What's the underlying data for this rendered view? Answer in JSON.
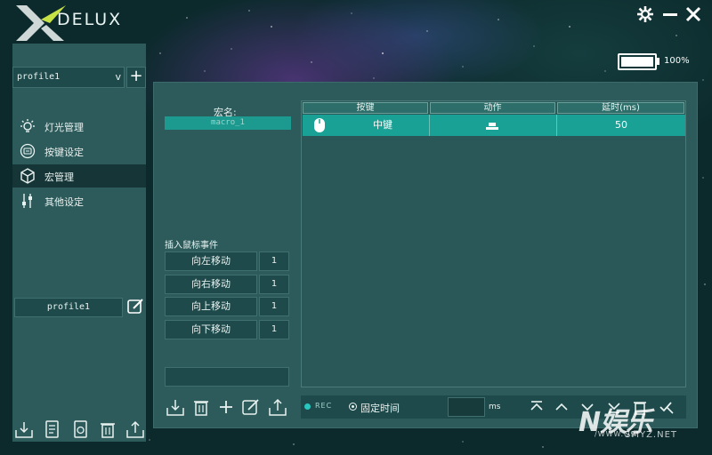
{
  "app": {
    "brand": "DELUX"
  },
  "window": {
    "settings_icon": "gear-icon",
    "minimize_icon": "minimize-icon",
    "close_icon": "close-icon"
  },
  "battery": {
    "level": 1.0,
    "text": "100%"
  },
  "sidebar": {
    "profile_select": {
      "value": "profile1",
      "arrow": "v"
    },
    "add_button": "+",
    "items": [
      {
        "label": "灯光管理",
        "icon": "light-bulb-icon",
        "active": false
      },
      {
        "label": "按键设定",
        "icon": "keyboard-icon",
        "active": false
      },
      {
        "label": "宏管理",
        "icon": "cube-icon",
        "active": true
      },
      {
        "label": "其他设定",
        "icon": "sliders-icon",
        "active": false
      }
    ],
    "profile_name": "profile1",
    "bottom_tools": [
      "import-icon",
      "notes-icon",
      "sync-icon",
      "trash-icon",
      "export-icon"
    ]
  },
  "macro": {
    "name_label": "宏名:",
    "name_value": "macro_1",
    "insert_label": "插入鼠标事件",
    "moves": [
      {
        "label": "向左移动",
        "value": "1"
      },
      {
        "label": "向右移动",
        "value": "1"
      },
      {
        "label": "向上移动",
        "value": "1"
      },
      {
        "label": "向下移动",
        "value": "1"
      }
    ],
    "tools": [
      "import-icon",
      "trash-icon",
      "add-icon",
      "edit-icon",
      "export-icon"
    ]
  },
  "table": {
    "headers": [
      "按键",
      "动作",
      "延时(ms)"
    ],
    "rows": [
      {
        "key": "中键",
        "action_icon": "press-down-icon",
        "delay": "50"
      }
    ]
  },
  "record_bar": {
    "rec_label": "REC",
    "fixed_label": "固定时间",
    "ms_value": "",
    "ms_unit": "ms",
    "order_tools": [
      "move-top-icon",
      "move-up-icon",
      "move-down-icon",
      "move-bottom-icon",
      "delete-row-icon",
      "clear-icon"
    ]
  },
  "watermark": {
    "main": "N娱乐",
    "sub": "SMYZ.NET",
    "small": "/WWW.Q9"
  }
}
